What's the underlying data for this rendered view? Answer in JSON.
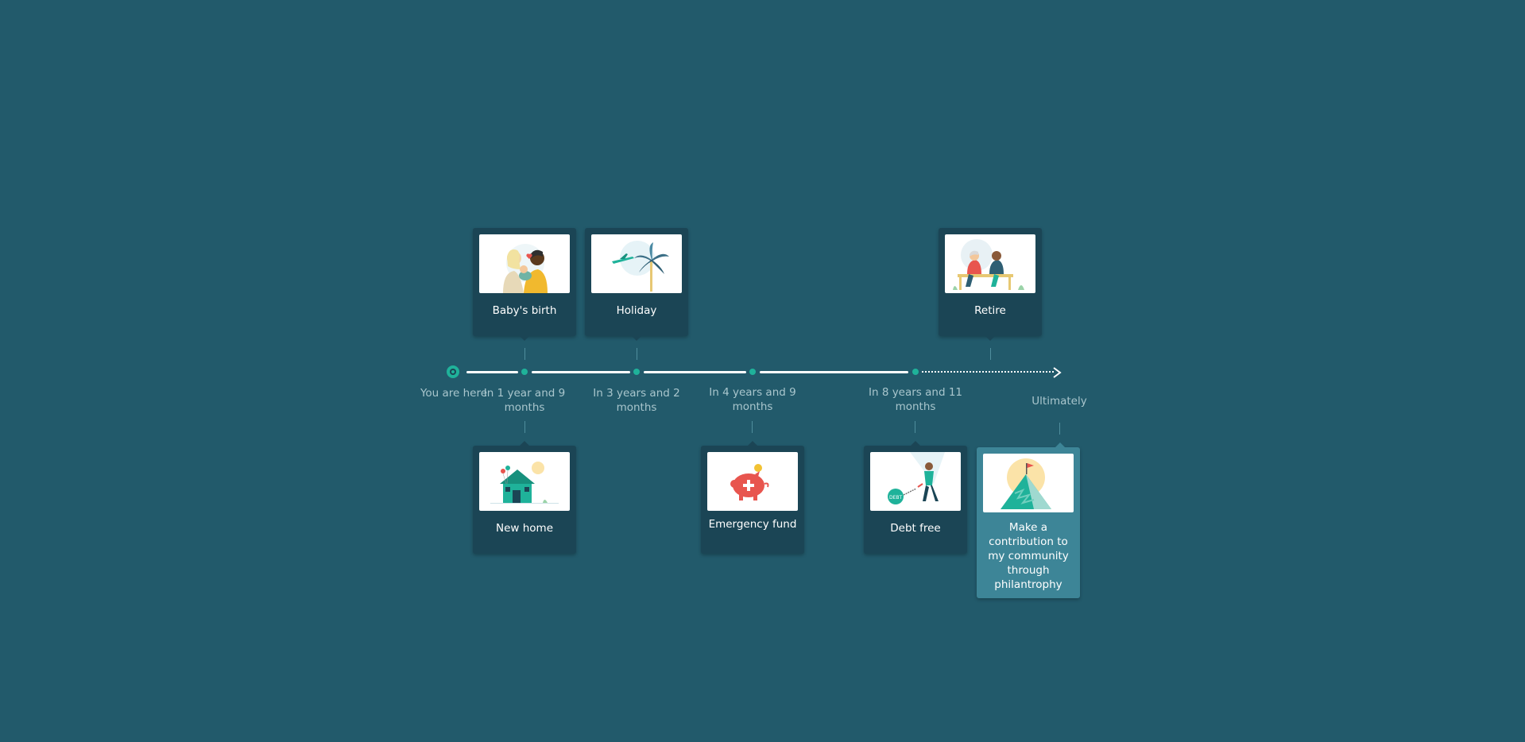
{
  "start": {
    "label": "You are here"
  },
  "milestones": [
    {
      "name": "Baby's birth",
      "time": "In 1 year and 9 months"
    },
    {
      "name": "New home",
      "time": "In 1 year and 9 months"
    },
    {
      "name": "Holiday",
      "time": "In 3 years and 2 months"
    },
    {
      "name": "Emergency fund",
      "time": "In 4 years and 9 months"
    },
    {
      "name": "Debt free",
      "time": "In 8 years and 11 months"
    },
    {
      "name": "Retire",
      "time": ""
    },
    {
      "name": "Make a contribution to my community through philantrophy",
      "time": "Ultimately"
    }
  ],
  "labels": {
    "t1": "In 1 year and 9 months",
    "t2": "In 3 years and 2 months",
    "t3": "In 4 years and 9 months",
    "t4": "In 8 years and 11 months",
    "t5": "Ultimately"
  },
  "icons": {
    "baby": "parents-with-baby-illustration",
    "holiday": "palm-tree-airplane-illustration",
    "retire": "elderly-couple-bench-illustration",
    "home": "house-balloons-illustration",
    "fund": "piggy-bank-illustration",
    "debt": "person-breaking-chain-illustration",
    "phil": "mountain-flag-illustration"
  },
  "colors": {
    "background": "#225a6b",
    "card": "#1b4555",
    "card_highlight": "#3d8597",
    "accent": "#1fb29a"
  }
}
